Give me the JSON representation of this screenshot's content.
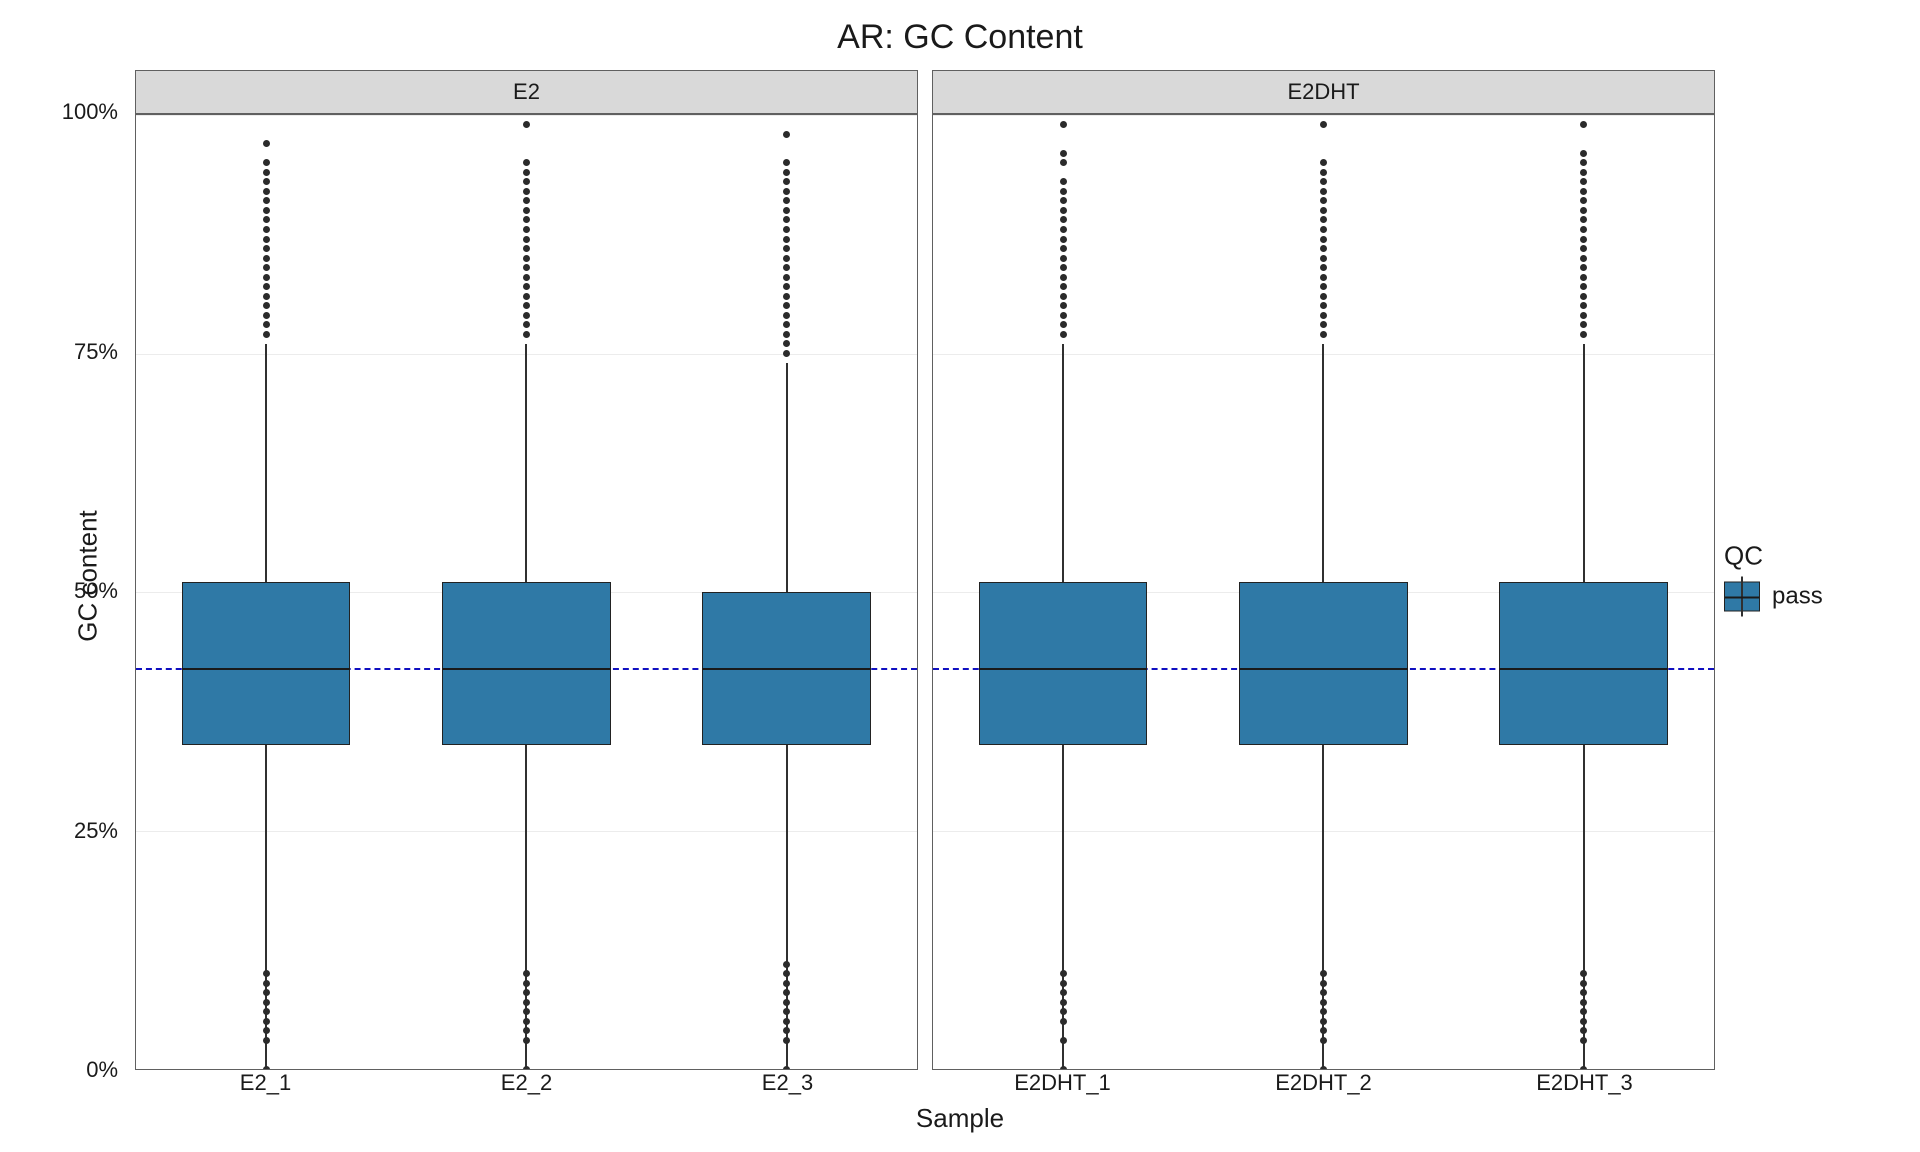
{
  "chart_data": {
    "type": "box",
    "title": "AR: GC Content",
    "xlabel": "Sample",
    "ylabel": "GC content",
    "ylim": [
      0,
      100
    ],
    "y_ticks": [
      0,
      25,
      50,
      75,
      100
    ],
    "y_tick_labels": [
      "0%",
      "25%",
      "50%",
      "75%",
      "100%"
    ],
    "reference_line": 42,
    "facets": [
      {
        "label": "E2",
        "categories": [
          "E2_1",
          "E2_2",
          "E2_3"
        ],
        "boxes": [
          {
            "q1": 34,
            "median": 42,
            "q3": 51,
            "whisker_low": 0,
            "whisker_high": 76,
            "outliers_low": [
              0,
              3,
              4,
              5,
              6,
              7,
              8,
              9,
              10
            ],
            "outliers_high": [
              77,
              78,
              79,
              80,
              81,
              82,
              83,
              84,
              85,
              86,
              87,
              88,
              89,
              90,
              91,
              92,
              93,
              94,
              95,
              97
            ]
          },
          {
            "q1": 34,
            "median": 42,
            "q3": 51,
            "whisker_low": 0,
            "whisker_high": 76,
            "outliers_low": [
              0,
              3,
              4,
              5,
              6,
              7,
              8,
              9,
              10
            ],
            "outliers_high": [
              77,
              78,
              79,
              80,
              81,
              82,
              83,
              84,
              85,
              86,
              87,
              88,
              89,
              90,
              91,
              92,
              93,
              94,
              95,
              99
            ]
          },
          {
            "q1": 34,
            "median": 42,
            "q3": 50,
            "whisker_low": 0,
            "whisker_high": 74,
            "outliers_low": [
              0,
              3,
              4,
              5,
              6,
              7,
              8,
              9,
              10,
              11
            ],
            "outliers_high": [
              75,
              76,
              77,
              78,
              79,
              80,
              81,
              82,
              83,
              84,
              85,
              86,
              87,
              88,
              89,
              90,
              91,
              92,
              93,
              94,
              95,
              98
            ]
          }
        ]
      },
      {
        "label": "E2DHT",
        "categories": [
          "E2DHT_1",
          "E2DHT_2",
          "E2DHT_3"
        ],
        "boxes": [
          {
            "q1": 34,
            "median": 42,
            "q3": 51,
            "whisker_low": 0,
            "whisker_high": 76,
            "outliers_low": [
              0,
              3,
              5,
              6,
              7,
              8,
              9,
              10
            ],
            "outliers_high": [
              77,
              78,
              79,
              80,
              81,
              82,
              83,
              84,
              85,
              86,
              87,
              88,
              89,
              90,
              91,
              92,
              93,
              95,
              96,
              99
            ]
          },
          {
            "q1": 34,
            "median": 42,
            "q3": 51,
            "whisker_low": 0,
            "whisker_high": 76,
            "outliers_low": [
              0,
              3,
              4,
              5,
              6,
              7,
              8,
              9,
              10
            ],
            "outliers_high": [
              77,
              78,
              79,
              80,
              81,
              82,
              83,
              84,
              85,
              86,
              87,
              88,
              89,
              90,
              91,
              92,
              93,
              94,
              95,
              99
            ]
          },
          {
            "q1": 34,
            "median": 42,
            "q3": 51,
            "whisker_low": 0,
            "whisker_high": 76,
            "outliers_low": [
              0,
              3,
              4,
              5,
              6,
              7,
              8,
              9,
              10
            ],
            "outliers_high": [
              77,
              78,
              79,
              80,
              81,
              82,
              83,
              84,
              85,
              86,
              87,
              88,
              89,
              90,
              91,
              92,
              93,
              94,
              95,
              96,
              99
            ]
          }
        ]
      }
    ],
    "legend": {
      "title": "QC",
      "items": [
        {
          "label": "pass",
          "color": "#2f79a6"
        }
      ]
    }
  }
}
